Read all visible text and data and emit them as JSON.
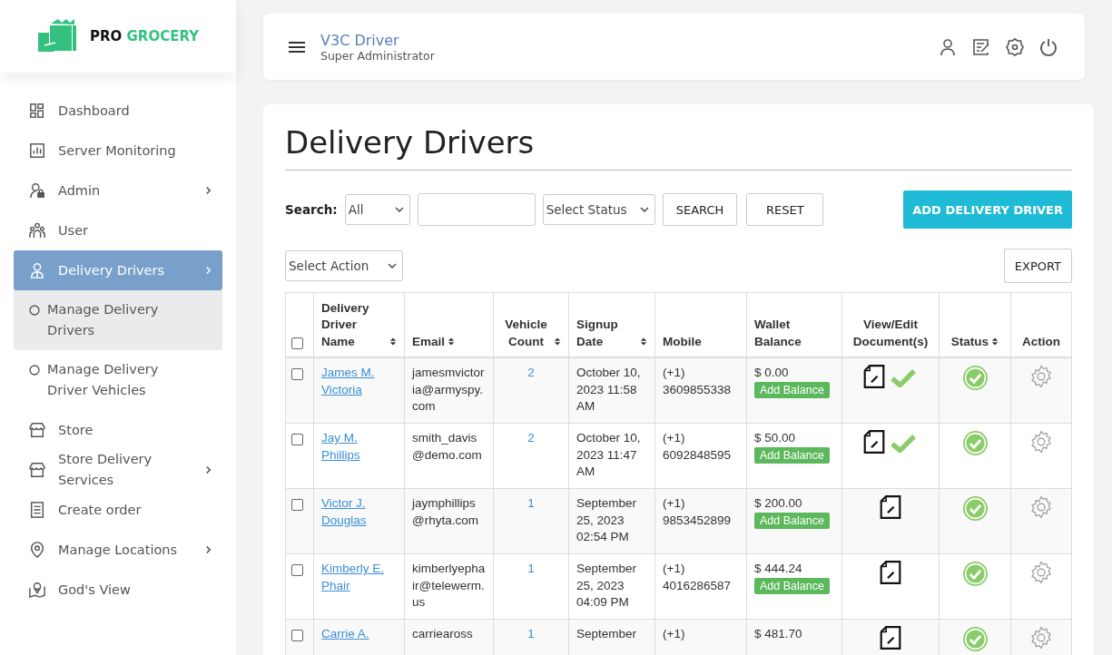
{
  "brand": {
    "word_1": "PRO",
    "word_2": "GROCERY"
  },
  "sidebar": {
    "items": [
      {
        "label": "Dashboard",
        "has_arrow": false,
        "selected": false
      },
      {
        "label": "Server Monitoring",
        "has_arrow": false,
        "selected": false
      },
      {
        "label": "Admin",
        "has_arrow": true,
        "selected": false
      },
      {
        "label": "User",
        "has_arrow": false,
        "selected": false
      },
      {
        "label": "Delivery Drivers",
        "has_arrow": true,
        "selected": true,
        "expanded": true,
        "children": [
          {
            "label": "Manage Delivery Drivers",
            "selected": true
          },
          {
            "label": "Manage Delivery Driver Vehicles",
            "selected": false
          }
        ]
      },
      {
        "label": "Store",
        "has_arrow": false,
        "selected": false
      },
      {
        "label": "Store Delivery Services",
        "has_arrow": true,
        "selected": false
      },
      {
        "label": "Create order",
        "has_arrow": false,
        "selected": false
      },
      {
        "label": "Manage Locations",
        "has_arrow": true,
        "selected": false
      },
      {
        "label": "God's View",
        "has_arrow": false,
        "selected": false
      }
    ]
  },
  "header": {
    "user_name": "V3C Driver",
    "role": "Super Administrator"
  },
  "page": {
    "title": "Delivery Drivers",
    "search_label": "Search:",
    "search_by": "All",
    "search_status": "Select Status",
    "search_button": "SEARCH",
    "reset_button": "RESET",
    "add_button": "ADD DELIVERY DRIVER",
    "action_select": "Select Action",
    "export_button": "EXPORT"
  },
  "table": {
    "all_checked": false,
    "columns": [
      {
        "label": "Delivery Driver Name",
        "sortable": true
      },
      {
        "label": "Email",
        "sortable": true
      },
      {
        "label": "Vehicle Count",
        "sortable": true
      },
      {
        "label": "Signup Date",
        "sortable": true
      },
      {
        "label": "Mobile",
        "sortable": false
      },
      {
        "label": "Wallet Balance",
        "sortable": false
      },
      {
        "label": "View/Edit Document(s)",
        "sortable": false
      },
      {
        "label": "Status",
        "sortable": true
      },
      {
        "label": "Action",
        "sortable": false
      }
    ],
    "rows": [
      {
        "checked": false,
        "name": "James M. Victoria",
        "email": "jamesmvictoria@armyspy.com",
        "vehicles": "2",
        "signup": "October 10, 2023 11:58 AM",
        "mobile": "(+1) 3609855338",
        "balance": "$ 0.00",
        "balance_button": "Add Balance",
        "docs_approved": true,
        "active": true
      },
      {
        "checked": false,
        "name": "Jay M. Phillips",
        "email": "smith_davis@demo.com",
        "vehicles": "2",
        "signup": "October 10, 2023 11:47 AM",
        "mobile": "(+1) 6092848595",
        "balance": "$ 50.00",
        "balance_button": "Add Balance",
        "docs_approved": true,
        "active": true
      },
      {
        "checked": false,
        "name": "Victor J. Douglas",
        "email": "jaymphillips@rhyta.com",
        "vehicles": "1",
        "signup": "September 25, 2023 02:54 PM",
        "mobile": "(+1) 9853452899",
        "balance": "$ 200.00",
        "balance_button": "Add Balance",
        "docs_approved": false,
        "active": true
      },
      {
        "checked": false,
        "name": "Kimberly E. Phair",
        "email": "kimberlyephair@telewerm.us",
        "vehicles": "1",
        "signup": "September 25, 2023 04:09 PM",
        "mobile": "(+1) 4016286587",
        "balance": "$ 444.24",
        "balance_button": "Add Balance",
        "docs_approved": false,
        "active": true
      },
      {
        "checked": false,
        "name": "Carrie A.",
        "email": "carrieaross",
        "vehicles": "1",
        "signup": "September",
        "mobile": "(+1)",
        "balance": "$ 481.70",
        "docs_approved": false,
        "active": true
      }
    ]
  }
}
